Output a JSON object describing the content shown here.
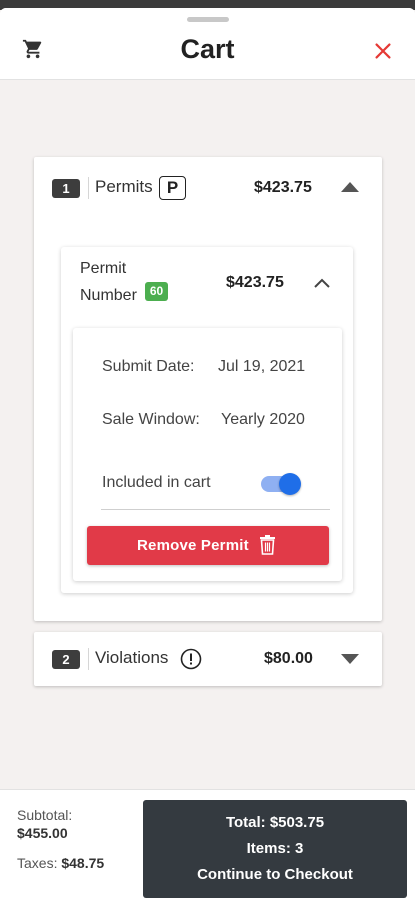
{
  "header": {
    "title": "Cart",
    "left_icon": "shopping-cart-icon",
    "close_icon": "close-icon",
    "close_color": "#e53935"
  },
  "permits_section": {
    "index": "1",
    "label": "Permits",
    "badge_letter": "P",
    "price": "$423.75",
    "expanded": true,
    "permit": {
      "title_line1": "Permit",
      "title_line2": "Number",
      "number_badge": "60",
      "price": "$423.75",
      "expanded": true,
      "details": {
        "submit_date_label": "Submit Date:",
        "submit_date_value": "Jul 19, 2021",
        "sale_window_label": "Sale Window:",
        "sale_window_value": "Yearly 2020",
        "included_label": "Included in cart",
        "included": true,
        "remove_label": "Remove Permit"
      }
    }
  },
  "violations_section": {
    "index": "2",
    "label": "Violations",
    "price": "$80.00",
    "expanded": false
  },
  "footer": {
    "subtotal_label": "Subtotal:",
    "subtotal_value": "$455.00",
    "taxes_label": "Taxes:",
    "taxes_value": "$48.75",
    "checkout": {
      "total_line": "Total: $503.75",
      "items_line": "Items: 3",
      "action_line": "Continue to Checkout"
    }
  },
  "colors": {
    "accent_red": "#e13a48",
    "toggle_blue": "#1f6ee8",
    "badge_green": "#4cae4f",
    "dark_button": "#343a40"
  }
}
